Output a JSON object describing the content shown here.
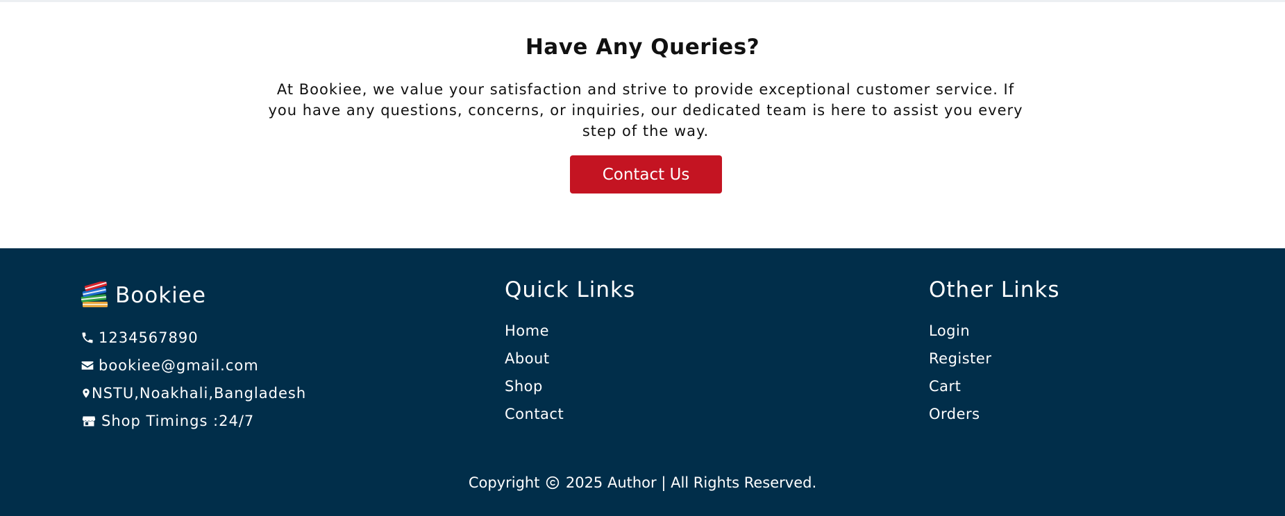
{
  "queries": {
    "title": "Have Any Queries?",
    "text": "At Bookiee, we value your satisfaction and strive to provide exceptional customer service. If you have any questions, concerns, or inquiries, our dedicated team is here to assist you every step of the way.",
    "button_label": "Contact Us"
  },
  "footer": {
    "brand": {
      "name": "Bookiee",
      "icon": "books-icon"
    },
    "info": [
      {
        "icon": "phone-icon",
        "text": "1234567890"
      },
      {
        "icon": "envelope-icon",
        "text": "bookiee@gmail.com"
      },
      {
        "icon": "map-marker-icon",
        "text": "NSTU,Noakhali,Bangladesh"
      },
      {
        "icon": "store-icon",
        "text": "Shop Timings :24/7"
      }
    ],
    "quick_links": {
      "title": "Quick Links",
      "items": [
        "Home",
        "About",
        "Shop",
        "Contact"
      ]
    },
    "other_links": {
      "title": "Other Links",
      "items": [
        "Login",
        "Register",
        "Cart",
        "Orders"
      ]
    },
    "copyright": {
      "before": "Copyright",
      "after": "2025 Author | All Rights Reserved."
    }
  },
  "colors": {
    "footer_bg": "#012e4a",
    "button_bg": "#c41422",
    "text_light": "#ffffff"
  }
}
